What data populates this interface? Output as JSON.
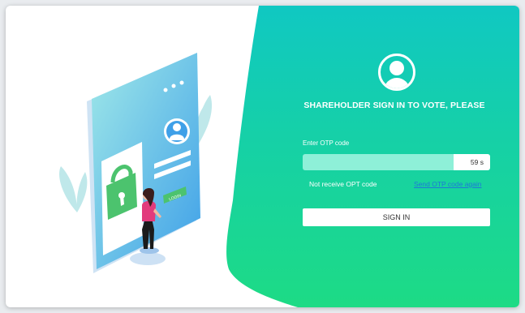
{
  "form": {
    "heading": "SHAREHOLDER SIGN IN TO VOTE, PLEASE",
    "otp_label": "Enter OTP code",
    "otp_value": "",
    "otp_timer": "59 s",
    "no_otp_text": "Not receive OPT code",
    "resend_link": "Send OTP code again",
    "signin_button": "SIGN IN"
  },
  "illustration": {
    "login_button_text": "LOGIN"
  },
  "colors": {
    "gradient_start": "#10c8c2",
    "gradient_end": "#1ddb85",
    "link": "#1e78d8",
    "otp_field": "#8ef0d8"
  },
  "icons": [
    "user-avatar-icon",
    "padlock-icon",
    "profile-icon"
  ]
}
